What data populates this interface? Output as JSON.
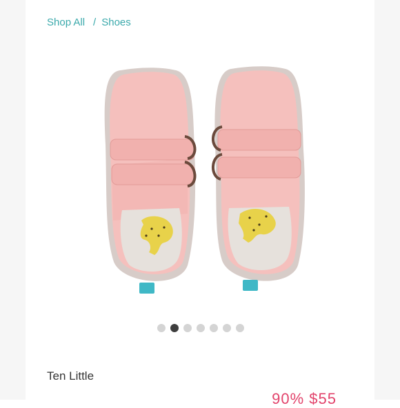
{
  "breadcrumb": {
    "items": [
      "Shop All",
      "Shoes"
    ],
    "separator": "/",
    "link_color": "#3aa9ab"
  },
  "product": {
    "brand": "Ten Little",
    "image_icon": "pink-velcro-sneakers-with-cheetah-insole",
    "price_partial": "90% $55",
    "price_color": "#e2436b"
  },
  "carousel": {
    "total": 7,
    "active_index": 1
  }
}
